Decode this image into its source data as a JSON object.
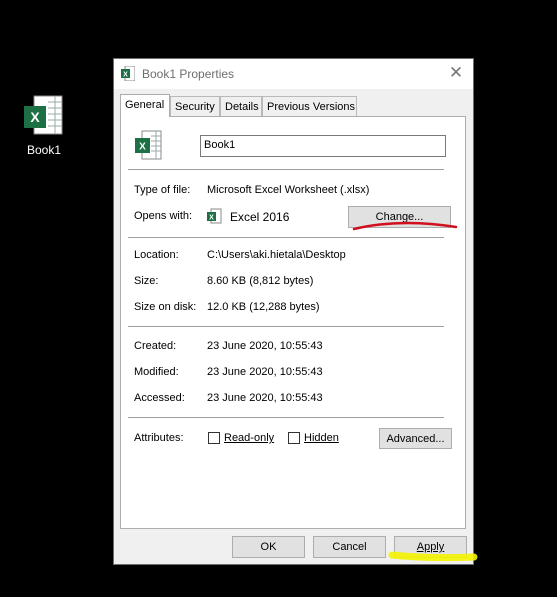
{
  "desktop": {
    "icon_label": "Book1",
    "icon": "excel-file-icon"
  },
  "dialog": {
    "title": "Book1 Properties",
    "tabs": [
      {
        "label": "General",
        "active": true
      },
      {
        "label": "Security",
        "active": false
      },
      {
        "label": "Details",
        "active": false
      },
      {
        "label": "Previous Versions",
        "active": false
      }
    ],
    "file_name": "Book1",
    "type_of_file_label": "Type of file:",
    "type_of_file_value": "Microsoft Excel Worksheet (.xlsx)",
    "opens_with_label": "Opens with:",
    "opens_with_value": "Excel 2016",
    "change_button": "Change...",
    "location_label": "Location:",
    "location_value": "C:\\Users\\aki.hietala\\Desktop",
    "size_label": "Size:",
    "size_value": "8.60 KB (8,812 bytes)",
    "size_on_disk_label": "Size on disk:",
    "size_on_disk_value": "12.0 KB (12,288 bytes)",
    "created_label": "Created:",
    "created_value": "23 June 2020, 10:55:43",
    "modified_label": "Modified:",
    "modified_value": "23 June 2020, 10:55:43",
    "accessed_label": "Accessed:",
    "accessed_value": "23 June 2020, 10:55:43",
    "attributes_label": "Attributes:",
    "readonly_label": "Read-only",
    "hidden_label": "Hidden",
    "advanced_button": "Advanced...",
    "ok_button": "OK",
    "cancel_button": "Cancel",
    "apply_button": "Apply"
  },
  "colors": {
    "excel_green": "#1d7044",
    "annotation_red": "#d0101c",
    "annotation_yellow": "#f4f400"
  }
}
